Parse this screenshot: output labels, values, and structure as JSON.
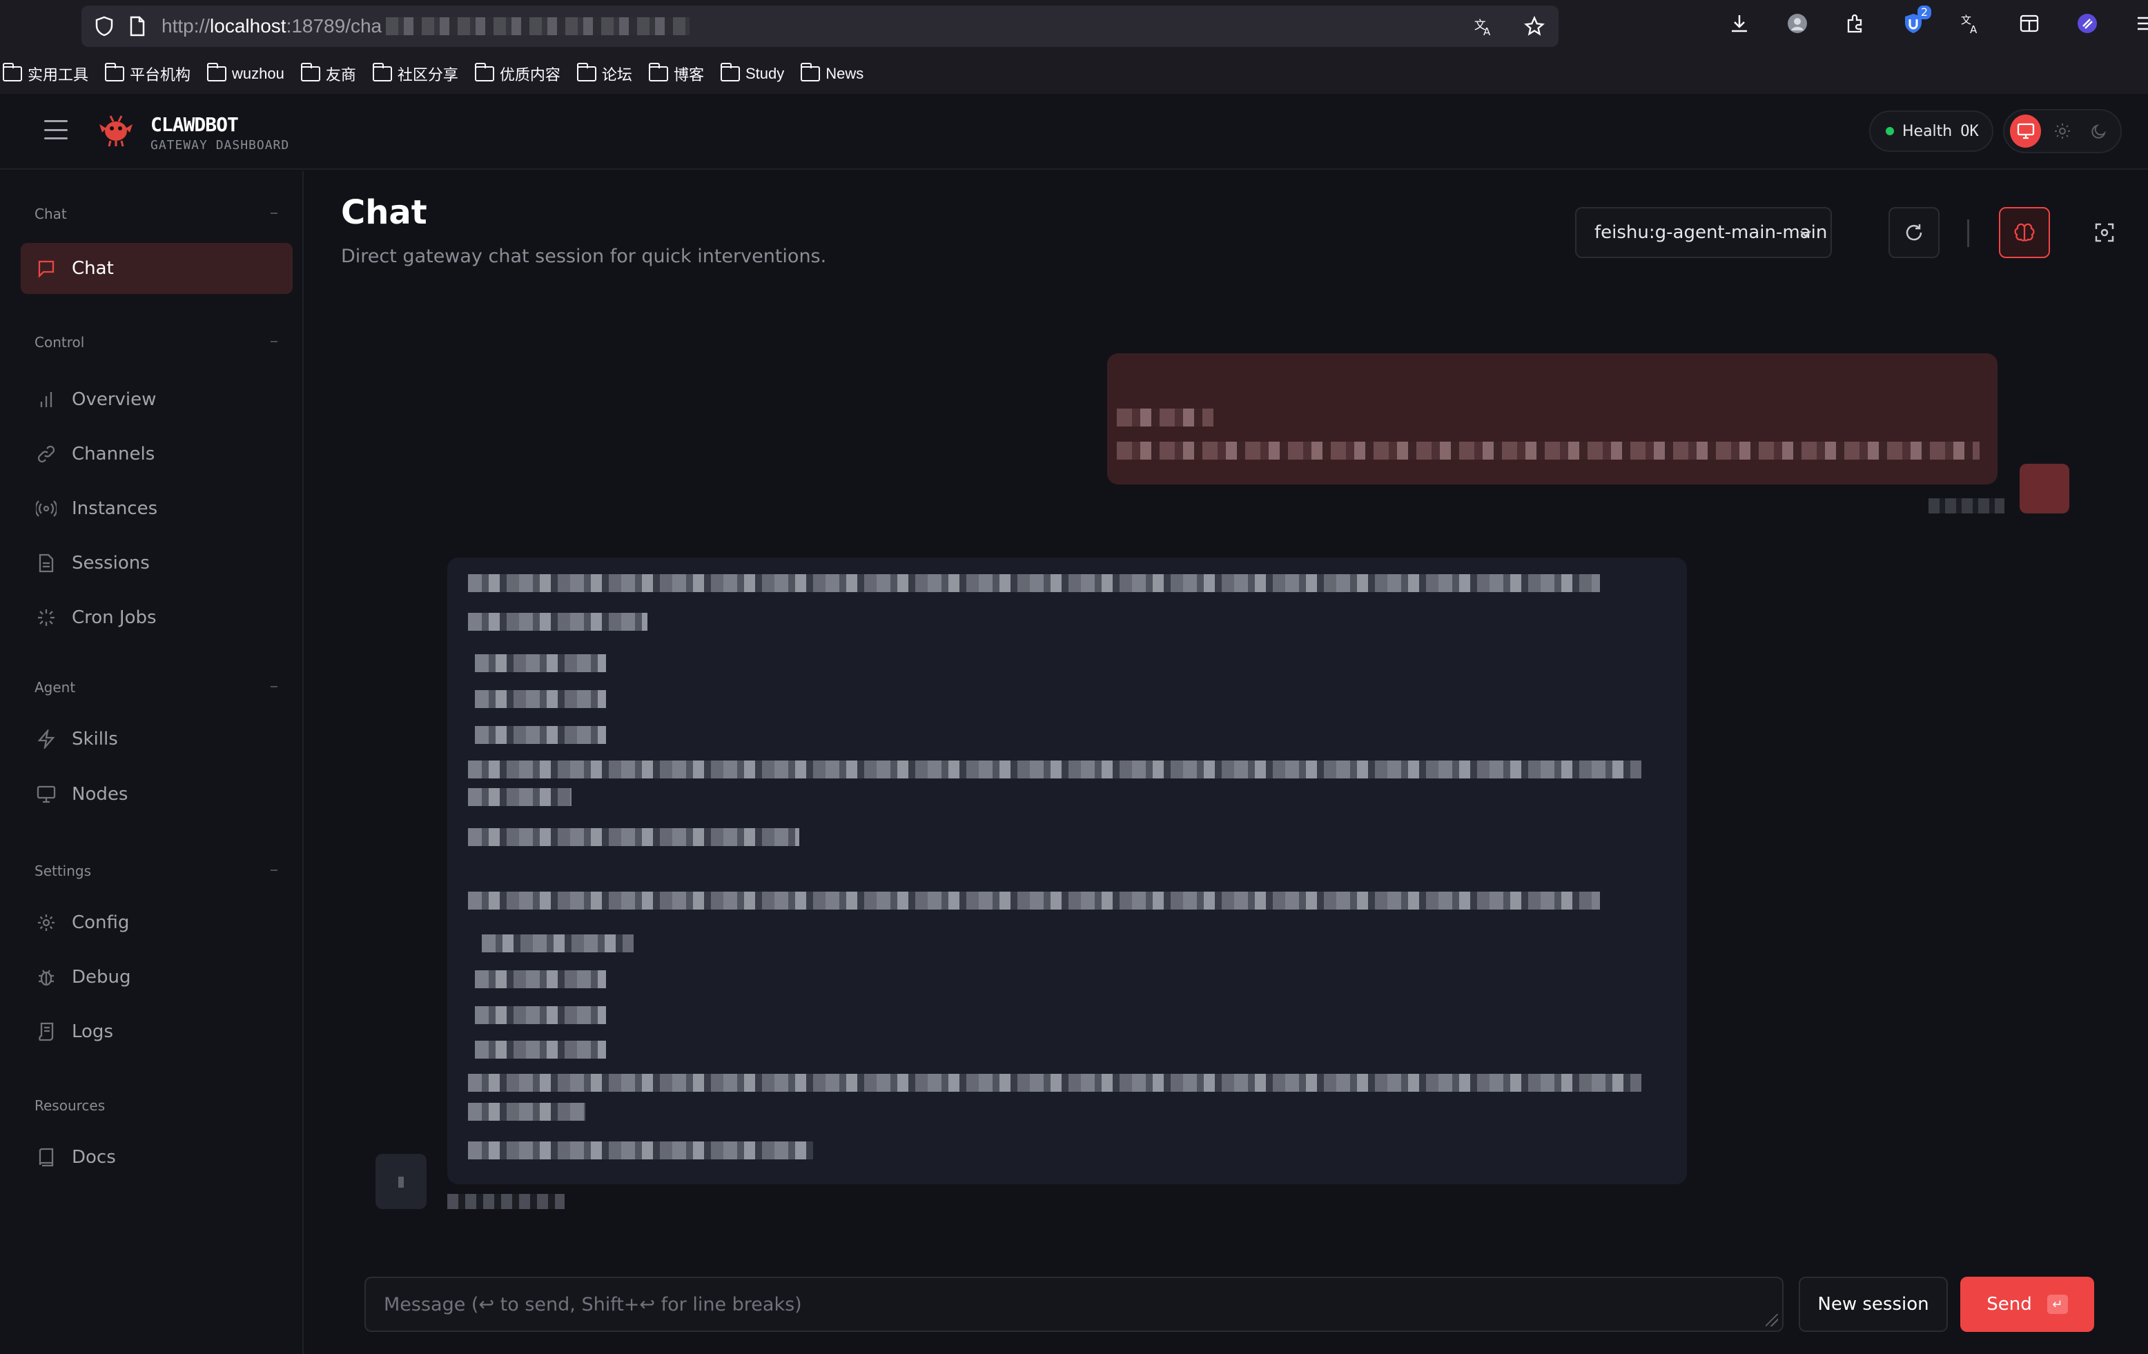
{
  "browser": {
    "url_prefix": "http://",
    "url_host": "localhost",
    "url_rest": ":18789/cha",
    "toolbar_badge": "2",
    "bookmarks": [
      "实用工具",
      "平台机构",
      "wuzhou",
      "友商",
      "社区分享",
      "优质内容",
      "论坛",
      "博客",
      "Study",
      "News"
    ]
  },
  "app": {
    "brand_title": "CLAWDBOT",
    "brand_subtitle": "GATEWAY DASHBOARD",
    "health_label": "Health",
    "health_value": "OK",
    "accent_color": "#ef4444",
    "health_color": "#22c55e"
  },
  "sidebar": {
    "sections": [
      {
        "title": "Chat",
        "items": [
          {
            "label": "Chat",
            "icon": "message-icon",
            "active": true
          }
        ]
      },
      {
        "title": "Control",
        "items": [
          {
            "label": "Overview",
            "icon": "bar-chart-icon"
          },
          {
            "label": "Channels",
            "icon": "link-icon"
          },
          {
            "label": "Instances",
            "icon": "radio-icon"
          },
          {
            "label": "Sessions",
            "icon": "file-icon"
          },
          {
            "label": "Cron Jobs",
            "icon": "loader-icon"
          }
        ]
      },
      {
        "title": "Agent",
        "items": [
          {
            "label": "Skills",
            "icon": "zap-icon"
          },
          {
            "label": "Nodes",
            "icon": "monitor-icon"
          }
        ]
      },
      {
        "title": "Settings",
        "items": [
          {
            "label": "Config",
            "icon": "gear-icon"
          },
          {
            "label": "Debug",
            "icon": "bug-icon"
          },
          {
            "label": "Logs",
            "icon": "scroll-icon"
          }
        ]
      },
      {
        "title": "Resources",
        "items": [
          {
            "label": "Docs",
            "icon": "book-icon"
          }
        ]
      }
    ]
  },
  "main": {
    "title": "Chat",
    "subtitle": "Direct gateway chat session for quick interventions.",
    "session_value": "feishu:g-agent-main-main"
  },
  "composer": {
    "placeholder": "Message (↩ to send, Shift+↩ for line breaks)",
    "new_session_label": "New session",
    "send_label": "Send",
    "send_kbd": "↵"
  }
}
